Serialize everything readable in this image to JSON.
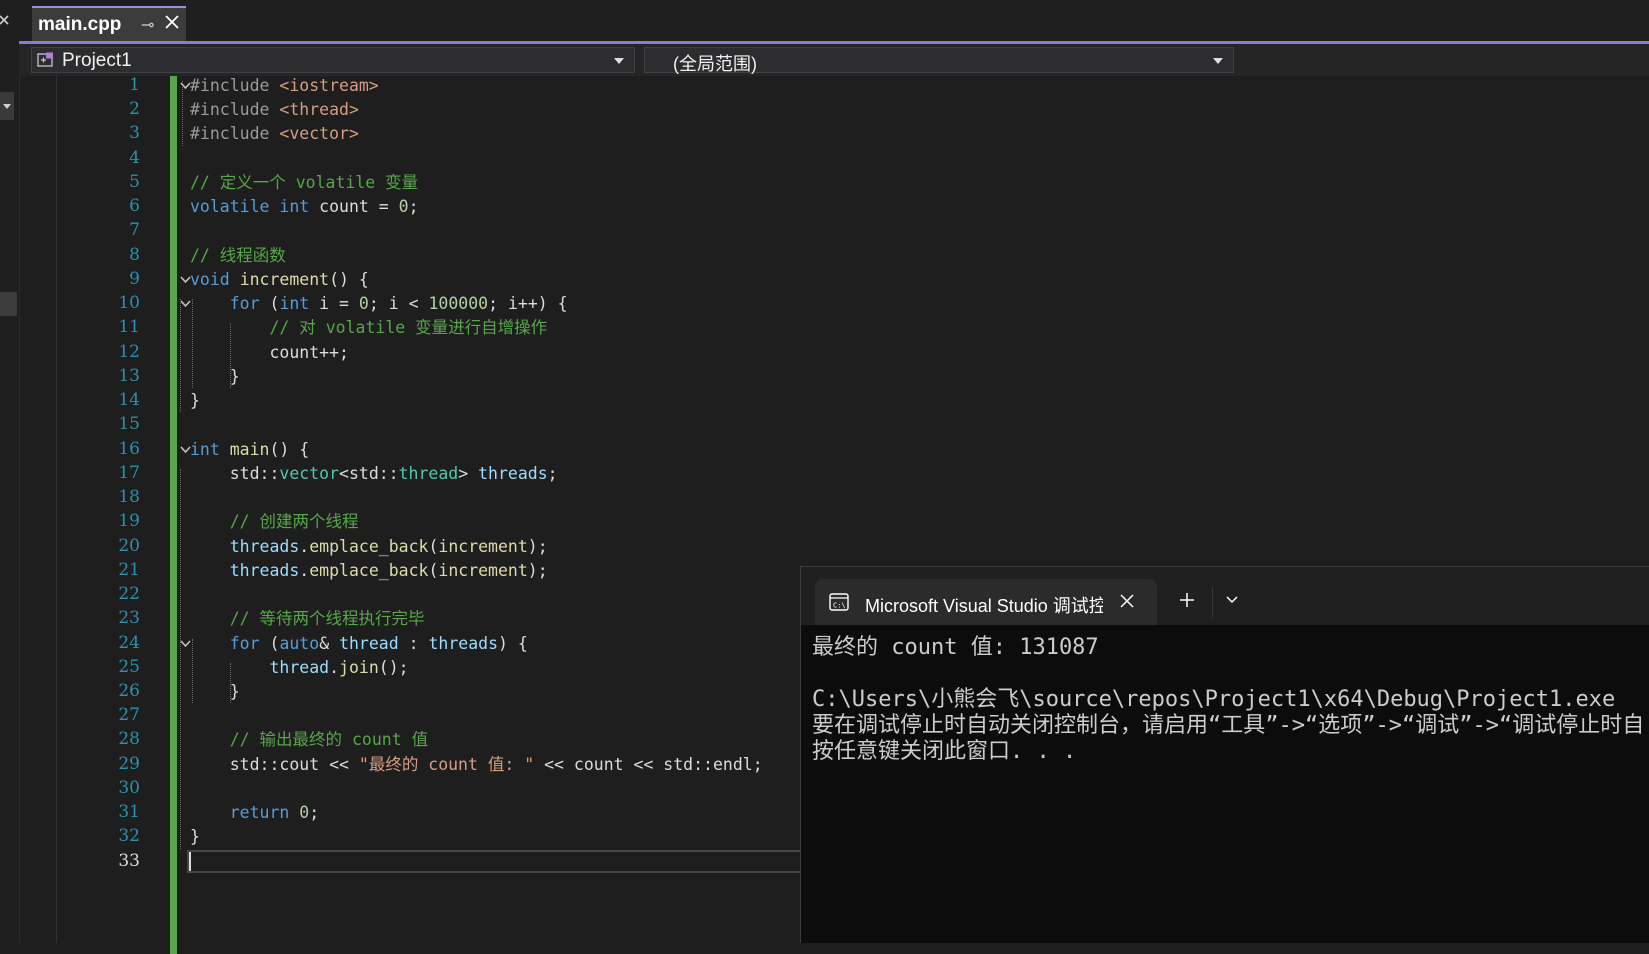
{
  "tab": {
    "filename": "main.cpp",
    "pin_glyph": "⊸"
  },
  "nav": {
    "project": "Project1",
    "scope": "(全局范围)"
  },
  "editor": {
    "current_line": 33,
    "line_numbers": [
      "1",
      "2",
      "3",
      "4",
      "5",
      "6",
      "7",
      "8",
      "9",
      "10",
      "11",
      "12",
      "13",
      "14",
      "15",
      "16",
      "17",
      "18",
      "19",
      "20",
      "21",
      "22",
      "23",
      "24",
      "25",
      "26",
      "27",
      "28",
      "29",
      "30",
      "31",
      "32",
      "33"
    ],
    "lines": [
      [
        {
          "c": "pp",
          "t": "#include "
        },
        {
          "c": "st",
          "t": "<iostream>"
        }
      ],
      [
        {
          "c": "pp",
          "t": "#include "
        },
        {
          "c": "st",
          "t": "<thread>"
        }
      ],
      [
        {
          "c": "pp",
          "t": "#include "
        },
        {
          "c": "st",
          "t": "<vector>"
        }
      ],
      [],
      [
        {
          "c": "cm",
          "t": "// 定义一个 volatile 变量"
        }
      ],
      [
        {
          "c": "kw",
          "t": "volatile"
        },
        {
          "c": "df",
          "t": " "
        },
        {
          "c": "kw",
          "t": "int"
        },
        {
          "c": "df",
          "t": " count = "
        },
        {
          "c": "nm",
          "t": "0"
        },
        {
          "c": "df",
          "t": ";"
        }
      ],
      [],
      [
        {
          "c": "cm",
          "t": "// 线程函数"
        }
      ],
      [
        {
          "c": "kw",
          "t": "void"
        },
        {
          "c": "df",
          "t": " "
        },
        {
          "c": "fn",
          "t": "increment"
        },
        {
          "c": "df",
          "t": "() {"
        }
      ],
      [
        {
          "c": "df",
          "t": "    "
        },
        {
          "c": "kw",
          "t": "for"
        },
        {
          "c": "df",
          "t": " ("
        },
        {
          "c": "kw",
          "t": "int"
        },
        {
          "c": "df",
          "t": " i = "
        },
        {
          "c": "nm",
          "t": "0"
        },
        {
          "c": "df",
          "t": "; i < "
        },
        {
          "c": "nm",
          "t": "100000"
        },
        {
          "c": "df",
          "t": "; i++) {"
        }
      ],
      [
        {
          "c": "df",
          "t": "        "
        },
        {
          "c": "cm",
          "t": "// 对 volatile 变量进行自增操作"
        }
      ],
      [
        {
          "c": "df",
          "t": "        count++;"
        }
      ],
      [
        {
          "c": "df",
          "t": "    }"
        }
      ],
      [
        {
          "c": "df",
          "t": "}"
        }
      ],
      [],
      [
        {
          "c": "kw",
          "t": "int"
        },
        {
          "c": "df",
          "t": " "
        },
        {
          "c": "fn",
          "t": "main"
        },
        {
          "c": "df",
          "t": "() {"
        }
      ],
      [
        {
          "c": "df",
          "t": "    std::"
        },
        {
          "c": "ty",
          "t": "vector"
        },
        {
          "c": "df",
          "t": "<std::"
        },
        {
          "c": "ty",
          "t": "thread"
        },
        {
          "c": "df",
          "t": "> "
        },
        {
          "c": "var",
          "t": "threads"
        },
        {
          "c": "df",
          "t": ";"
        }
      ],
      [],
      [
        {
          "c": "df",
          "t": "    "
        },
        {
          "c": "cm",
          "t": "// 创建两个线程"
        }
      ],
      [
        {
          "c": "df",
          "t": "    "
        },
        {
          "c": "var",
          "t": "threads"
        },
        {
          "c": "df",
          "t": "."
        },
        {
          "c": "fn",
          "t": "emplace_back"
        },
        {
          "c": "df",
          "t": "("
        },
        {
          "c": "fn",
          "t": "increment"
        },
        {
          "c": "df",
          "t": ");"
        }
      ],
      [
        {
          "c": "df",
          "t": "    "
        },
        {
          "c": "var",
          "t": "threads"
        },
        {
          "c": "df",
          "t": "."
        },
        {
          "c": "fn",
          "t": "emplace_back"
        },
        {
          "c": "df",
          "t": "("
        },
        {
          "c": "fn",
          "t": "increment"
        },
        {
          "c": "df",
          "t": ");"
        }
      ],
      [],
      [
        {
          "c": "df",
          "t": "    "
        },
        {
          "c": "cm",
          "t": "// 等待两个线程执行完毕"
        }
      ],
      [
        {
          "c": "df",
          "t": "    "
        },
        {
          "c": "kw",
          "t": "for"
        },
        {
          "c": "df",
          "t": " ("
        },
        {
          "c": "kw",
          "t": "auto"
        },
        {
          "c": "df",
          "t": "& "
        },
        {
          "c": "var",
          "t": "thread"
        },
        {
          "c": "df",
          "t": " : "
        },
        {
          "c": "var",
          "t": "threads"
        },
        {
          "c": "df",
          "t": ") {"
        }
      ],
      [
        {
          "c": "df",
          "t": "        "
        },
        {
          "c": "var",
          "t": "thread"
        },
        {
          "c": "df",
          "t": "."
        },
        {
          "c": "fn",
          "t": "join"
        },
        {
          "c": "df",
          "t": "();"
        }
      ],
      [
        {
          "c": "df",
          "t": "    }"
        }
      ],
      [],
      [
        {
          "c": "df",
          "t": "    "
        },
        {
          "c": "cm",
          "t": "// 输出最终的 count 值"
        }
      ],
      [
        {
          "c": "df",
          "t": "    std::cout << "
        },
        {
          "c": "st",
          "t": "\"最终的 count 值: \""
        },
        {
          "c": "df",
          "t": " << count << std::endl;"
        }
      ],
      [],
      [
        {
          "c": "df",
          "t": "    "
        },
        {
          "c": "kw",
          "t": "return"
        },
        {
          "c": "df",
          "t": " "
        },
        {
          "c": "nm",
          "t": "0"
        },
        {
          "c": "df",
          "t": ";"
        }
      ],
      [
        {
          "c": "df",
          "t": "}"
        }
      ],
      []
    ]
  },
  "console": {
    "tab_title": "Microsoft Visual Studio 调试控制台",
    "new_tab": "+",
    "output": [
      "最终的 count 值: 131087",
      "",
      "C:\\Users\\小熊会飞\\source\\repos\\Project1\\x64\\Debug\\Project1.exe",
      "要在调试停止时自动关闭控制台，请启用“工具”->“选项”->“调试”->“调试停止时自动关闭控制台”。",
      "按任意键关闭此窗口. . ."
    ]
  },
  "colors": {
    "accent": "#8b7bd8",
    "change_bar": "#57a64a",
    "line_number": "#2b91af",
    "keyword": "#569cd6",
    "comment": "#57a64a",
    "string": "#d69d85"
  }
}
